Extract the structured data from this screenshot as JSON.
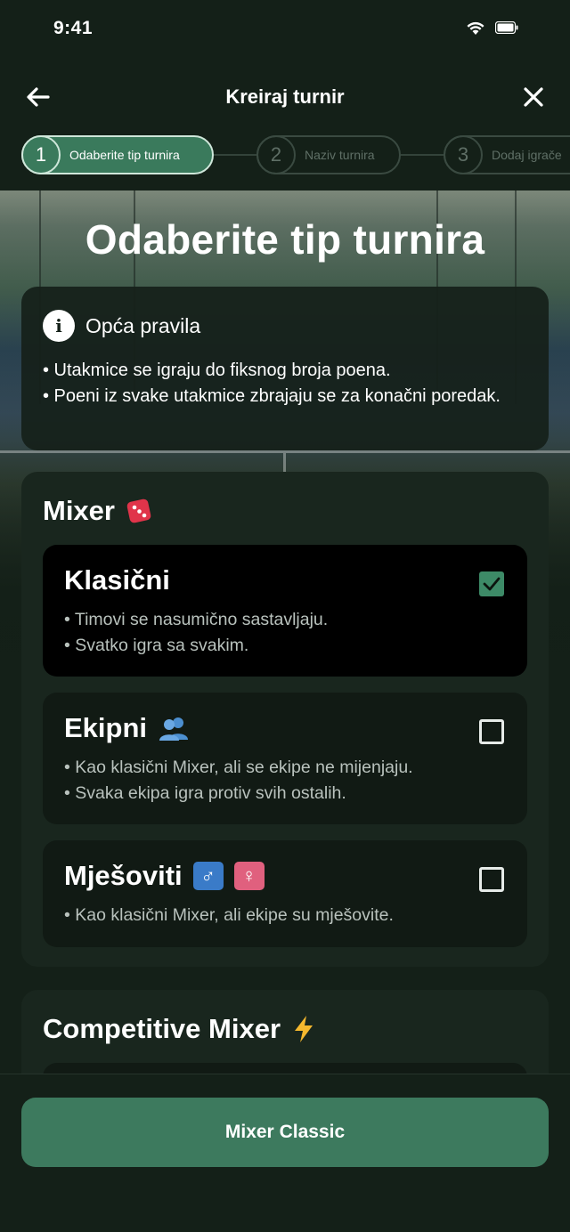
{
  "status": {
    "time": "9:41"
  },
  "nav": {
    "title": "Kreiraj turnir"
  },
  "steps": [
    {
      "num": "1",
      "label": "Odaberite tip turnira"
    },
    {
      "num": "2",
      "label": "Naziv turnira"
    },
    {
      "num": "3",
      "label": "Dodaj igrače"
    }
  ],
  "page": {
    "title": "Odaberite tip turnira"
  },
  "rules": {
    "title": "Opća pravila",
    "items": [
      "• Utakmice se igraju do fiksnog broja poena.",
      "• Poeni iz svake utakmice zbrajaju se za konačni poredak."
    ]
  },
  "mixer": {
    "title": "Mixer",
    "icon": "dice-icon",
    "options": [
      {
        "title": "Klasični",
        "selected": true,
        "lines": [
          "• Timovi se nasumično sastavljaju.",
          "• Svatko igra sa svakim."
        ]
      },
      {
        "title": "Ekipni",
        "icon": "people-icon",
        "selected": false,
        "lines": [
          "• Kao klasični Mixer, ali se ekipe ne mijenjaju.",
          "• Svaka ekipa igra protiv svih ostalih."
        ]
      },
      {
        "title": "Mješoviti",
        "icons": [
          "male-sign-icon",
          "female-sign-icon"
        ],
        "selected": false,
        "lines": [
          "• Kao klasični Mixer, ali ekipe su mješovite."
        ]
      }
    ]
  },
  "competitive": {
    "title": "Competitive Mixer",
    "icon": "lightning-icon"
  },
  "footer": {
    "button_label": "Mixer Classic"
  },
  "colors": {
    "accent": "#3d7a5e",
    "background": "#142018",
    "card": "#19261e"
  }
}
